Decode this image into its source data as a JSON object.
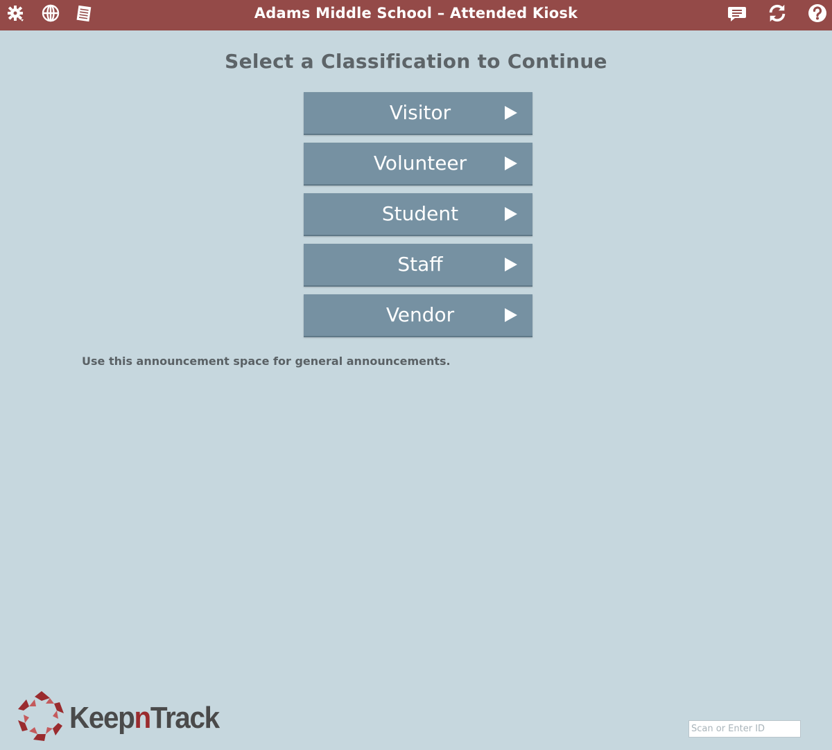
{
  "header": {
    "title": "Adams Middle School – Attended Kiosk",
    "left_icons": [
      "settings-gear-icon",
      "globe-icon",
      "notepad-icon"
    ],
    "right_icons": [
      "message-icon",
      "refresh-icon",
      "help-icon"
    ],
    "bar_color": "#944a48"
  },
  "main": {
    "heading": "Select a Classification to Continue",
    "classifications": [
      {
        "label": "Visitor"
      },
      {
        "label": "Volunteer"
      },
      {
        "label": "Student"
      },
      {
        "label": "Staff"
      },
      {
        "label": "Vendor"
      }
    ],
    "announcement": "Use this announcement space for general announcements."
  },
  "footer": {
    "logo_text_part1": "Keep",
    "logo_text_part2": "n",
    "logo_text_part3": "Track",
    "scan_input": {
      "placeholder": "Scan or Enter ID",
      "value": ""
    }
  },
  "colors": {
    "background": "#c6d7de",
    "button": "#7691a2",
    "brand_red": "#9a2b2e"
  }
}
